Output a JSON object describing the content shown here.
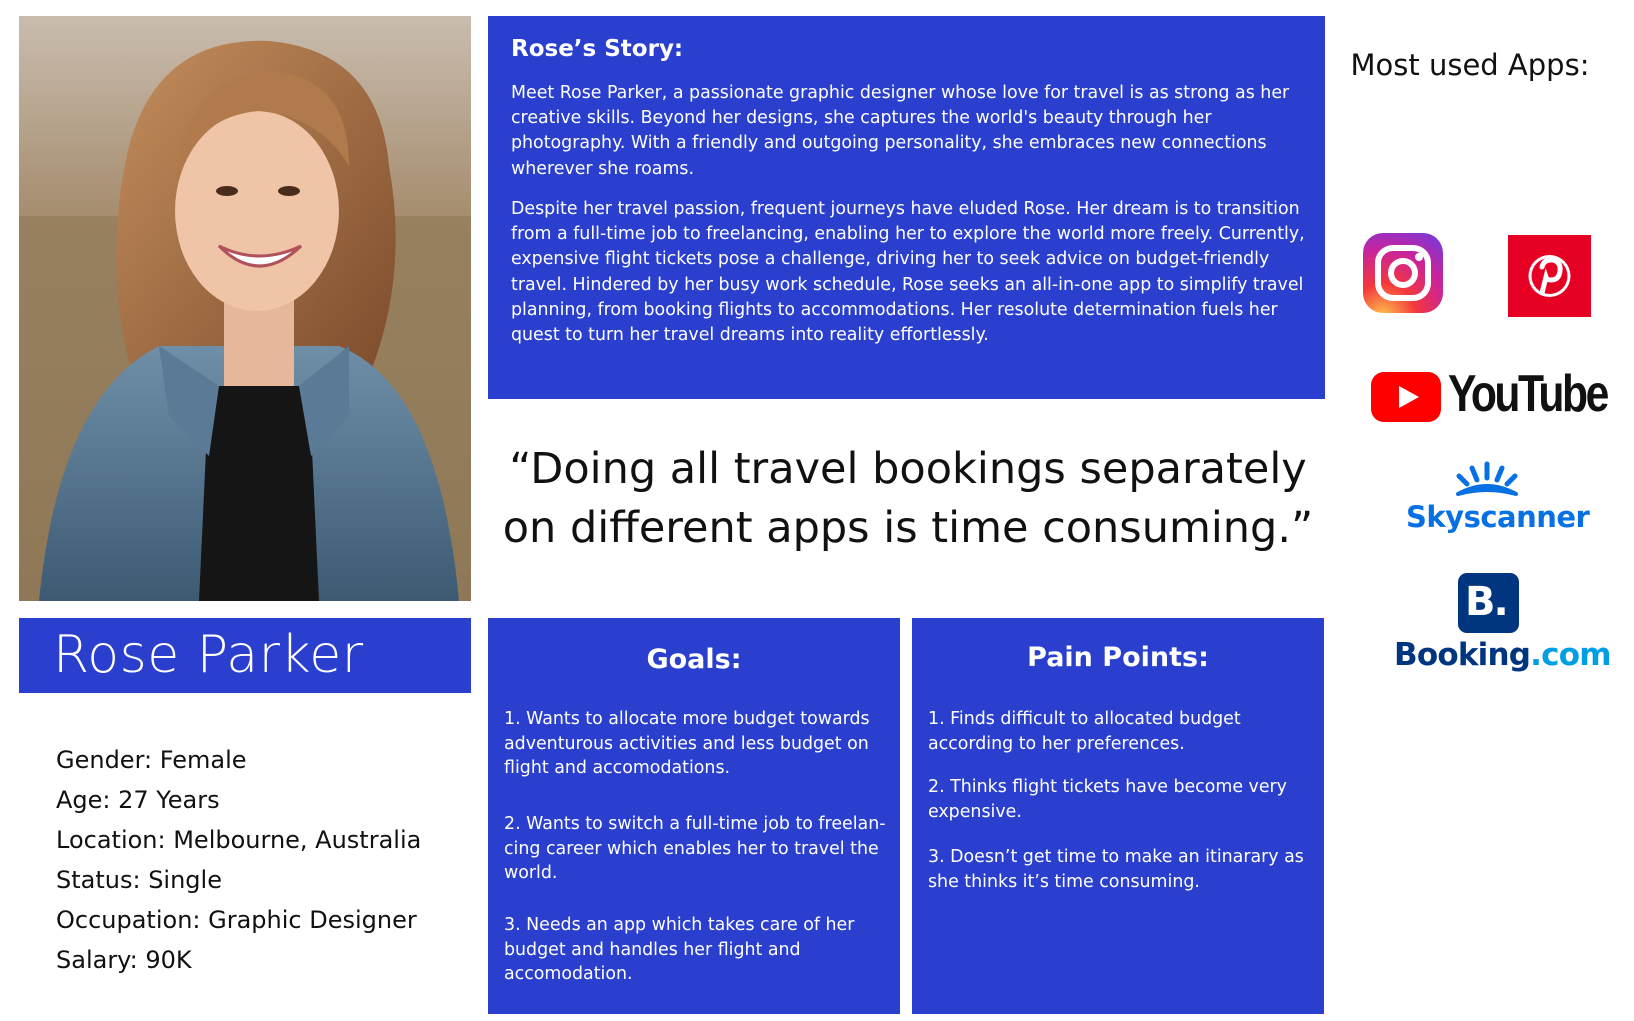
{
  "persona": {
    "name": "Rose Parker",
    "details": [
      "Gender: Female",
      "Age: 27 Years",
      "Location: Melbourne, Australia",
      "Status: Single",
      "Occupation: Graphic Designer",
      "Salary: 90K"
    ]
  },
  "story": {
    "title": "Rose’s Story:",
    "paragraphs": [
      "Meet Rose Parker, a passionate graphic designer whose love for travel is as strong as her creative skills. Beyond her designs, she captures the world's beauty through her photography. With a friendly and outgoing personality, she embraces new connections wherever she roams.",
      "Despite her travel passion, frequent journeys have eluded Rose. Her dream is to transition from a full-time job to freelancing, enabling her to explore the world more freely. Currently, expensive flight tickets pose a challenge, driving her to seek advice on budget-friendly travel. Hindered by her busy work schedule, Rose seeks an all-in-one app to simplify travel planning, from booking flights to accommodations. Her resolute determination fuels her quest to turn her travel dreams into reality effortlessly."
    ]
  },
  "quote": "“Doing all travel bookings separately on different apps is time consuming.”",
  "goals": {
    "title": "Goals:",
    "items": [
      "1. Wants to allocate more budget towards adventurous activities and less budget on flight and accomodations.",
      "2. Wants to switch a full-time job to freelan-cing career which enables her to travel the world.",
      "3. Needs an app which takes care of her budget and handles her flight and accomodation."
    ]
  },
  "pain_points": {
    "title": "Pain Points:",
    "items": [
      "1. Finds difficult to allocated budget according to her preferences.",
      "2. Thinks flight tickets have become very expensive.",
      "3. Doesn’t get time to make an itinarary as she thinks it’s time consuming."
    ]
  },
  "apps": {
    "title": "Most used Apps:",
    "logos": [
      {
        "icon": "instagram-icon"
      },
      {
        "icon": "pinterest-icon"
      },
      {
        "icon": "youtube-logo",
        "text": "YouTube"
      },
      {
        "icon": "skyscanner-logo",
        "text": "Skyscanner"
      },
      {
        "icon": "booking-logo",
        "badge": "B.",
        "text_main": "Booking",
        "text_suffix": ".com"
      }
    ]
  },
  "colors": {
    "card_blue": "#2b3fcf",
    "instagram_gradient": [
      "#fcc54a",
      "#f4373c",
      "#c8239b",
      "#7b38d8"
    ],
    "pinterest_red": "#e60023",
    "youtube_red": "#ff0000",
    "skyscanner_blue": "#0770e3",
    "booking_navy": "#003580",
    "booking_light_blue": "#009fe3"
  }
}
